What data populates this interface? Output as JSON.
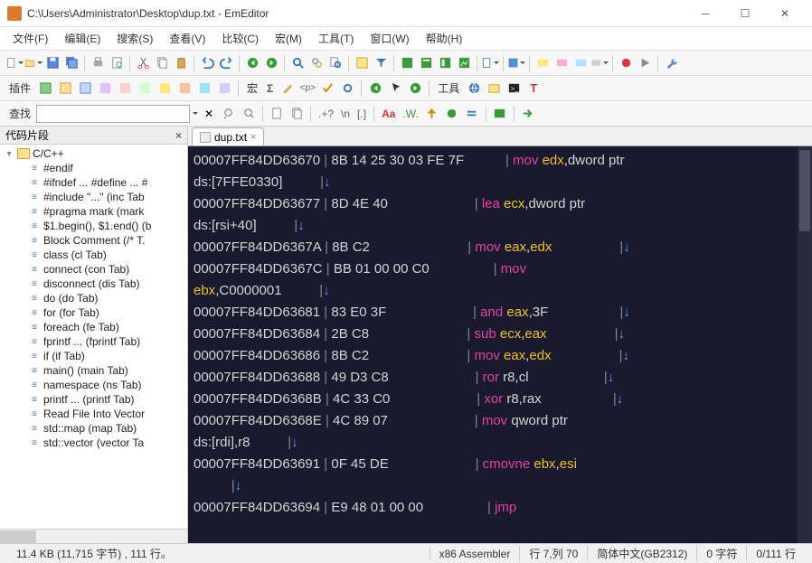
{
  "title": "C:\\Users\\Administrator\\Desktop\\dup.txt - EmEditor",
  "menu": [
    "文件(F)",
    "编辑(E)",
    "搜索(S)",
    "查看(V)",
    "比较(C)",
    "宏(M)",
    "工具(T)",
    "窗口(W)",
    "帮助(H)"
  ],
  "toolbar2": {
    "plugins_label": "插件",
    "macro_label": "宏",
    "sigma": "Σ",
    "tools_label": "工具"
  },
  "findbar": {
    "label": "查找",
    "regex1": ".+?",
    "regex2": "\\n",
    "regex3": "[.]",
    "aa": "Aa",
    "w": ".W."
  },
  "sidebar": {
    "title": "代码片段",
    "root": "C/C++",
    "items": [
      "#endif",
      "#ifndef ... #define ... #",
      "#include \"...\"  (inc Tab",
      "#pragma mark  (mark",
      "$1.begin(), $1.end()  (b",
      "Block Comment  (/* T.",
      "class  (cl Tab)",
      "connect  (con Tab)",
      "disconnect  (dis Tab)",
      "do  (do Tab)",
      "for  (for Tab)",
      "foreach  (fe Tab)",
      "fprintf ...  (fprintf Tab)",
      "if  (if Tab)",
      "main()  (main Tab)",
      "namespace  (ns Tab)",
      "printf ...  (printf Tab)",
      "Read File Into Vector",
      "std::map  (map Tab)",
      "std::vector  (vector Ta"
    ]
  },
  "tab": {
    "name": "dup.txt"
  },
  "code_lines": [
    {
      "addr": "00007FF84DD63670",
      "bytes": "8B 14 25 30 03 FE 7F",
      "op": "mov",
      "args": [
        {
          "t": "reg",
          "v": "edx"
        },
        {
          "t": "txt",
          "v": ",dword ptr"
        }
      ]
    },
    {
      "cont": true,
      "pre": "ds:[7FFE0330]",
      "arrow": true
    },
    {
      "addr": "00007FF84DD63677",
      "bytes": "8D 4E 40",
      "op": "lea",
      "args": [
        {
          "t": "reg",
          "v": "ecx"
        },
        {
          "t": "txt",
          "v": ",dword ptr"
        }
      ]
    },
    {
      "cont": true,
      "pre": "ds:[rsi+40]",
      "arrow": true
    },
    {
      "addr": "00007FF84DD6367A",
      "bytes": "8B C2",
      "op": "mov",
      "args": [
        {
          "t": "reg",
          "v": "eax"
        },
        {
          "t": "txt",
          "v": ","
        },
        {
          "t": "reg",
          "v": "edx"
        }
      ],
      "arrow": true
    },
    {
      "addr": "00007FF84DD6367C",
      "bytes": "BB 01 00 00 C0",
      "op": "mov",
      "args": []
    },
    {
      "cont": true,
      "prereg": "ebx",
      "pre": ",C0000001",
      "arrow": true
    },
    {
      "addr": "00007FF84DD63681",
      "bytes": "83 E0 3F",
      "op": "and",
      "args": [
        {
          "t": "reg",
          "v": "eax"
        },
        {
          "t": "txt",
          "v": ",3F"
        }
      ],
      "arrow": true
    },
    {
      "addr": "00007FF84DD63684",
      "bytes": "2B C8",
      "op": "sub",
      "args": [
        {
          "t": "reg",
          "v": "ecx"
        },
        {
          "t": "txt",
          "v": ","
        },
        {
          "t": "reg",
          "v": "eax"
        }
      ],
      "arrow": true
    },
    {
      "addr": "00007FF84DD63686",
      "bytes": "8B C2",
      "op": "mov",
      "args": [
        {
          "t": "reg",
          "v": "eax"
        },
        {
          "t": "txt",
          "v": ","
        },
        {
          "t": "reg",
          "v": "edx"
        }
      ],
      "arrow": true
    },
    {
      "addr": "00007FF84DD63688",
      "bytes": "49 D3 C8",
      "op": "ror",
      "args": [
        {
          "t": "txt",
          "v": "r8,cl"
        }
      ],
      "arrow": true
    },
    {
      "addr": "00007FF84DD6368B",
      "bytes": "4C 33 C0",
      "op": "xor",
      "args": [
        {
          "t": "txt",
          "v": "r8,rax"
        }
      ],
      "arrow": true
    },
    {
      "addr": "00007FF84DD6368E",
      "bytes": "4C 89 07",
      "op": "mov",
      "args": [
        {
          "t": "txt",
          "v": "qword ptr"
        }
      ]
    },
    {
      "cont": true,
      "pre": "ds:[rdi],r8",
      "arrow": true
    },
    {
      "addr": "00007FF84DD63691",
      "bytes": "0F 45 DE",
      "op": "cmovne",
      "args": [
        {
          "t": "reg",
          "v": "ebx"
        },
        {
          "t": "txt",
          "v": ","
        },
        {
          "t": "reg",
          "v": "esi"
        }
      ]
    },
    {
      "cont": true,
      "arrow": true
    },
    {
      "addr": "00007FF84DD63694",
      "bytes": "E9 48 01 00 00",
      "op": "jmp",
      "args": []
    }
  ],
  "status": {
    "left": "11.4 KB (11,715 字节) , 111 行。",
    "lang": "x86 Assembler",
    "pos": "行 7,列 70",
    "enc": "简体中文(GB2312)",
    "sel": "0 字符",
    "lines": "0/111 行"
  }
}
